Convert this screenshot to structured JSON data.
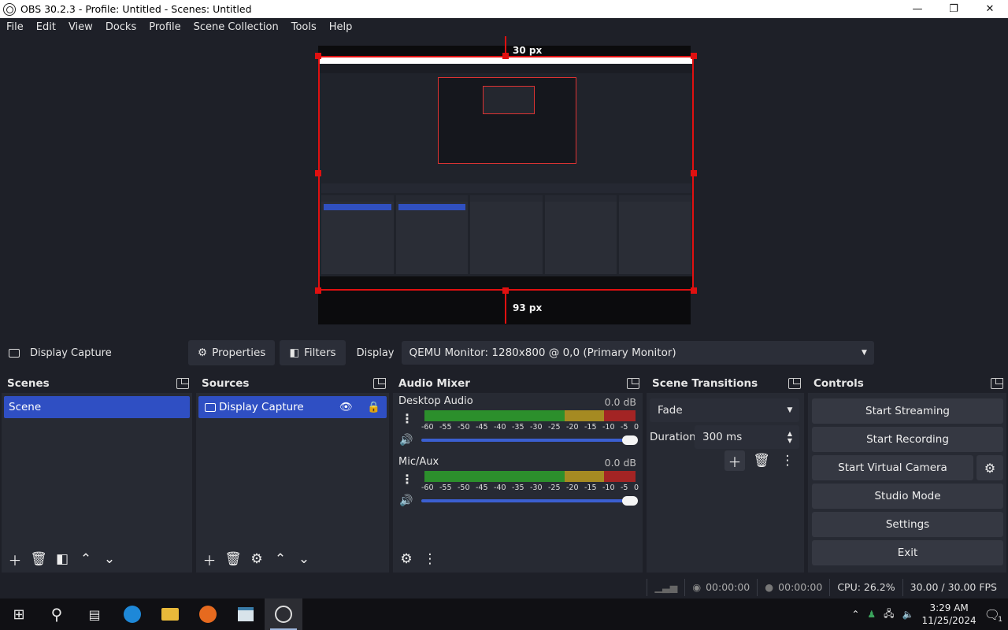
{
  "window": {
    "title": "OBS 30.2.3 - Profile: Untitled - Scenes: Untitled",
    "minimize": "—",
    "restore": "❐",
    "close": "✕"
  },
  "menu": [
    "File",
    "Edit",
    "View",
    "Docks",
    "Profile",
    "Scene Collection",
    "Tools",
    "Help"
  ],
  "preview": {
    "top_guide_label": "30 px",
    "bottom_guide_label": "93 px"
  },
  "source_toolbar": {
    "source_name": "Display Capture",
    "properties_label": "Properties",
    "filters_label": "Filters",
    "display_label": "Display",
    "display_value": "QEMU Monitor: 1280x800 @ 0,0 (Primary Monitor)"
  },
  "scenes": {
    "title": "Scenes",
    "items": [
      "Scene"
    ]
  },
  "sources": {
    "title": "Sources",
    "items": [
      "Display Capture"
    ]
  },
  "audio_mixer": {
    "title": "Audio Mixer",
    "scale": [
      "-60",
      "-55",
      "-50",
      "-45",
      "-40",
      "-35",
      "-30",
      "-25",
      "-20",
      "-15",
      "-10",
      "-5",
      "0"
    ],
    "channels": [
      {
        "name": "Desktop Audio",
        "db": "0.0 dB",
        "volume": 1.0
      },
      {
        "name": "Mic/Aux",
        "db": "0.0 dB",
        "volume": 1.0
      }
    ]
  },
  "transitions": {
    "title": "Scene Transitions",
    "type": "Fade",
    "duration_label": "Duration",
    "duration_value": "300 ms"
  },
  "controls": {
    "title": "Controls",
    "start_streaming": "Start Streaming",
    "start_recording": "Start Recording",
    "start_virtual_camera": "Start Virtual Camera",
    "studio_mode": "Studio Mode",
    "settings": "Settings",
    "exit": "Exit"
  },
  "status": {
    "stream_time": "00:00:00",
    "record_time": "00:00:00",
    "cpu": "CPU: 26.2%",
    "fps": "30.00 / 30.00 FPS"
  },
  "taskbar": {
    "time": "3:29 AM",
    "date": "11/25/2024",
    "notification_count": "1"
  },
  "colors": {
    "accent": "#2f4fc3",
    "guide_red": "#e01010",
    "meter_green": "#2c8f2c",
    "meter_yellow": "#a58a22",
    "meter_red": "#a32424"
  }
}
